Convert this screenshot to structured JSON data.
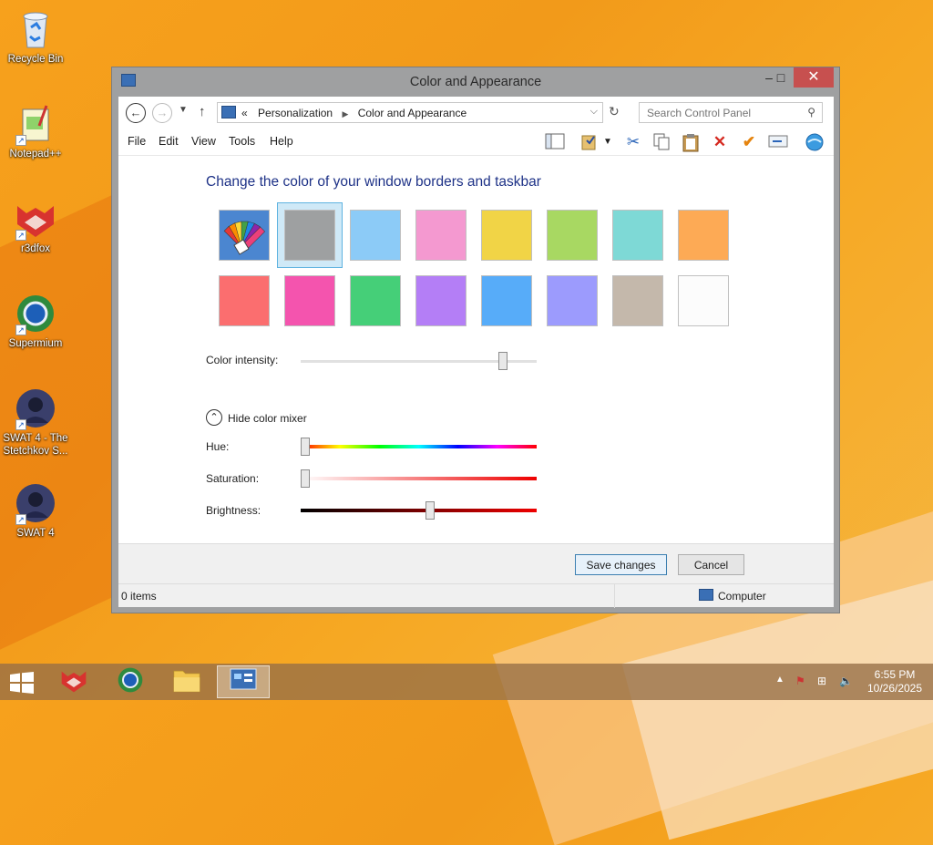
{
  "desktop": {
    "icons": [
      {
        "label": "Recycle Bin"
      },
      {
        "label": "Notepad++"
      },
      {
        "label": "r3dfox"
      },
      {
        "label": "Supermium"
      },
      {
        "label": "SWAT 4 - The Stetchkov S..."
      },
      {
        "label": "SWAT 4"
      }
    ]
  },
  "window": {
    "title": "Color and Appearance",
    "controls": {
      "minimize": "–",
      "maximize": "□",
      "close": "✕"
    }
  },
  "address": {
    "prefix": "«",
    "crumbs": [
      "Personalization",
      "Color and Appearance"
    ],
    "separator": "▶"
  },
  "search": {
    "placeholder": "Search Control Panel"
  },
  "menu": [
    "File",
    "Edit",
    "View",
    "Tools",
    "Help"
  ],
  "toolbar_icons": [
    "layout-icon",
    "properties-icon",
    "cut-icon",
    "copy-icon",
    "paste-icon",
    "delete-icon",
    "check-icon",
    "rename-icon",
    "internet-icon"
  ],
  "colors": {
    "heading": "Change the color of your window borders and taskbar",
    "selected_index": 1,
    "row1": [
      {
        "name": "automatic",
        "hex": "#3a6fb5"
      },
      {
        "name": "gray",
        "hex": "#9ea0a1"
      },
      {
        "name": "light-blue",
        "hex": "#8ccbf7"
      },
      {
        "name": "pink",
        "hex": "#f499d0"
      },
      {
        "name": "yellow",
        "hex": "#f1d446"
      },
      {
        "name": "lime",
        "hex": "#a8d862"
      },
      {
        "name": "teal",
        "hex": "#7ed9d6"
      },
      {
        "name": "orange",
        "hex": "#fdaa55"
      }
    ],
    "row2": [
      {
        "name": "red",
        "hex": "#fb6e6f"
      },
      {
        "name": "magenta",
        "hex": "#f454ae"
      },
      {
        "name": "green",
        "hex": "#45cf78"
      },
      {
        "name": "purple",
        "hex": "#b47ef6"
      },
      {
        "name": "blue",
        "hex": "#57acf9"
      },
      {
        "name": "periwinkle",
        "hex": "#9c9bfd"
      },
      {
        "name": "taupe",
        "hex": "#c4b8ab"
      },
      {
        "name": "white",
        "hex": "#fcfcfc"
      }
    ]
  },
  "intensity": {
    "label": "Color intensity:",
    "value": 0.87
  },
  "mixer": {
    "toggle_label": "Hide color mixer",
    "hue": {
      "label": "Hue:",
      "value": 0.0
    },
    "saturation": {
      "label": "Saturation:",
      "value": 0.0
    },
    "brightness": {
      "label": "Brightness:",
      "value": 0.55
    }
  },
  "buttons": {
    "save": "Save changes",
    "cancel": "Cancel"
  },
  "status": {
    "items": "0 items",
    "location": "Computer"
  },
  "taskbar": {
    "apps": [
      "r3dfox",
      "Supermium",
      "File Explorer",
      "Control Panel"
    ],
    "time": "6:55 PM",
    "date": "10/26/2025"
  }
}
